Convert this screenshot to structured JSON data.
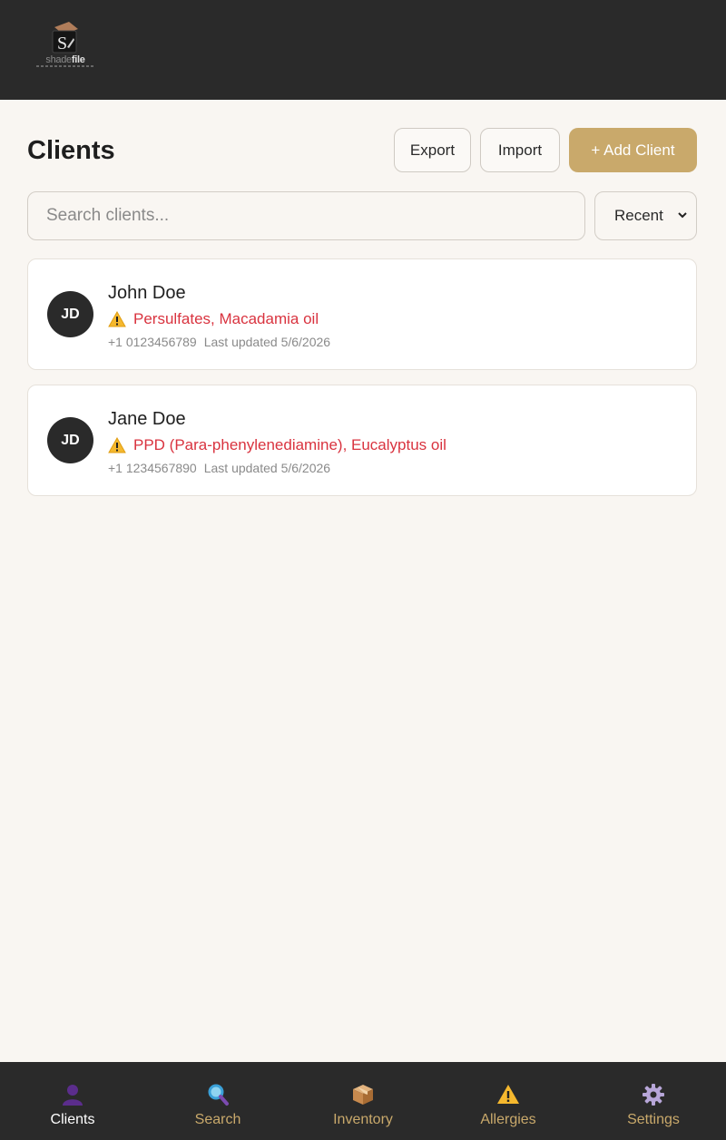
{
  "app": {
    "logo_text_light": "shade",
    "logo_text_bold": "file"
  },
  "header": {
    "title": "Clients",
    "export_label": "Export",
    "import_label": "Import",
    "add_label": "+ Add Client"
  },
  "search": {
    "placeholder": "Search clients...",
    "value": ""
  },
  "sort": {
    "selected": "Recent"
  },
  "clients": [
    {
      "initials": "JD",
      "name": "John Doe",
      "allergies": "Persulfates, Macadamia oil",
      "phone": "+1 0123456789",
      "updated": "Last updated 5/6/2026"
    },
    {
      "initials": "JD",
      "name": "Jane Doe",
      "allergies": "PPD (Para-phenylenediamine), Eucalyptus oil",
      "phone": "+1 1234567890",
      "updated": "Last updated 5/6/2026"
    }
  ],
  "nav": {
    "active": "Clients",
    "items": [
      {
        "label": "Clients",
        "icon": "person-icon"
      },
      {
        "label": "Search",
        "icon": "magnifier-icon"
      },
      {
        "label": "Inventory",
        "icon": "package-icon"
      },
      {
        "label": "Allergies",
        "icon": "warning-icon"
      },
      {
        "label": "Settings",
        "icon": "gear-icon"
      }
    ]
  },
  "colors": {
    "topbar": "#2a2a2a",
    "accent": "#c9a96b",
    "allergy_text": "#d9333f",
    "background": "#f9f6f2"
  }
}
